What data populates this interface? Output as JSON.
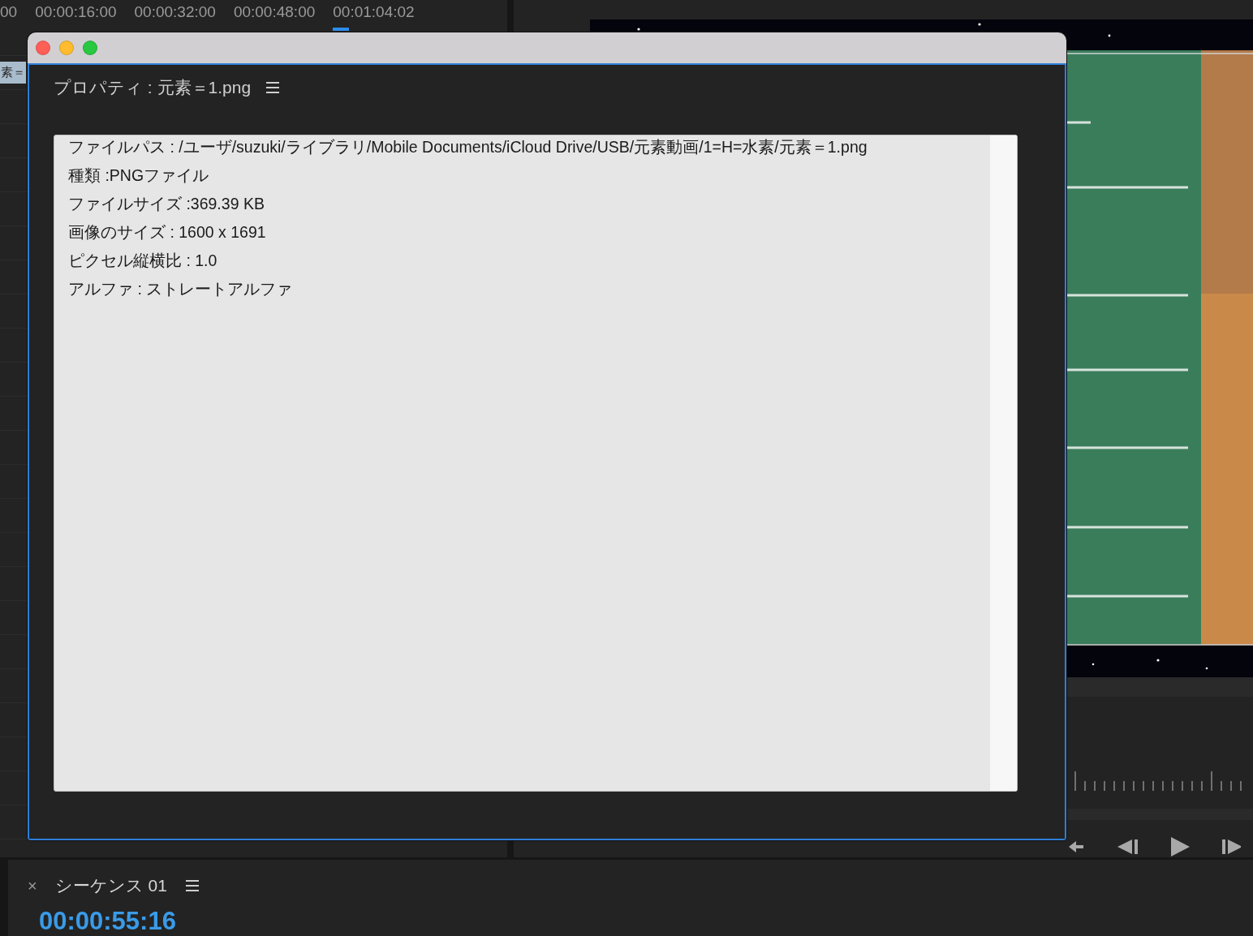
{
  "timeline": {
    "ruler_labels": [
      "00",
      "00:00:16:00",
      "00:00:32:00",
      "00:00:48:00",
      "00:01:04:02"
    ],
    "clip_label": "素＝"
  },
  "properties_window": {
    "title": "プロパティ : 元素＝1.png",
    "lines": [
      "ファイルパス : /ユーザ/suzuki/ライブラリ/Mobile Documents/iCloud Drive/USB/元素動画/1=H=水素/元素＝1.png",
      "種類 :PNGファイル",
      "ファイルサイズ :369.39 KB",
      "画像のサイズ : 1600 x 1691",
      "ピクセル縦横比 : 1.0",
      "アルファ : ストレートアルファ"
    ]
  },
  "sequence_panel": {
    "close": "×",
    "title": "シーケンス 01",
    "timecode": "00:00:55:16"
  }
}
